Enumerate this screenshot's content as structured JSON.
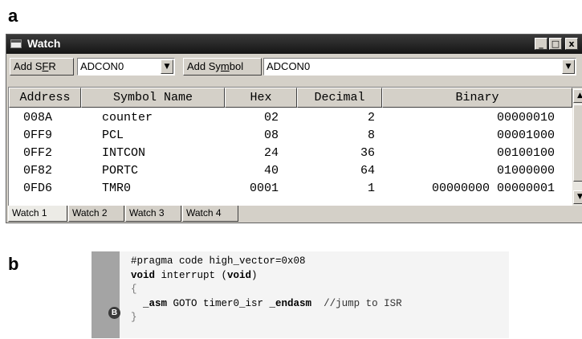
{
  "panel_labels": {
    "a": "a",
    "b": "b"
  },
  "window": {
    "title": "Watch",
    "controls": {
      "minimize": "_",
      "maximize": "□",
      "close": "x"
    }
  },
  "toolbar": {
    "add_sfr": {
      "prefix": "Add S",
      "accel": "F",
      "suffix": "R"
    },
    "sfr_value": "ADCON0",
    "add_symbol": {
      "prefix": "Add Sy",
      "accel": "m",
      "suffix": "bol"
    },
    "symbol_value": "ADCON0",
    "dropdown_arrow": "▼"
  },
  "table": {
    "headers": [
      "Address",
      "Symbol Name",
      "Hex",
      "Decimal",
      "Binary"
    ],
    "rows": [
      {
        "address": "008A",
        "symbol": "counter",
        "hex": "02",
        "decimal": "2",
        "binary": "00000010"
      },
      {
        "address": "0FF9",
        "symbol": "PCL",
        "hex": "08",
        "decimal": "8",
        "binary": "00001000"
      },
      {
        "address": "0FF2",
        "symbol": "INTCON",
        "hex": "24",
        "decimal": "36",
        "binary": "00100100"
      },
      {
        "address": "0F82",
        "symbol": "PORTC",
        "hex": "40",
        "decimal": "64",
        "binary": "01000000"
      },
      {
        "address": "0FD6",
        "symbol": "TMR0",
        "hex": "0001",
        "decimal": "1",
        "binary": "00000000 00000001"
      }
    ],
    "scroll_up": "▲",
    "scroll_down": "▼"
  },
  "tabs": [
    "Watch 1",
    "Watch 2",
    "Watch 3",
    "Watch 4"
  ],
  "code": {
    "breakpoint_label": "B",
    "line1": "#pragma code high_vector=0x08",
    "line2": {
      "kw1": "void",
      "mid": " interrupt (",
      "kw2": "void",
      "end": ")"
    },
    "line3": "{",
    "line4": {
      "lead": "  _asm",
      "mid": " GOTO timer0_isr ",
      "kw": "_endasm",
      "comment": "  //jump to ISR"
    },
    "line5": "}"
  }
}
